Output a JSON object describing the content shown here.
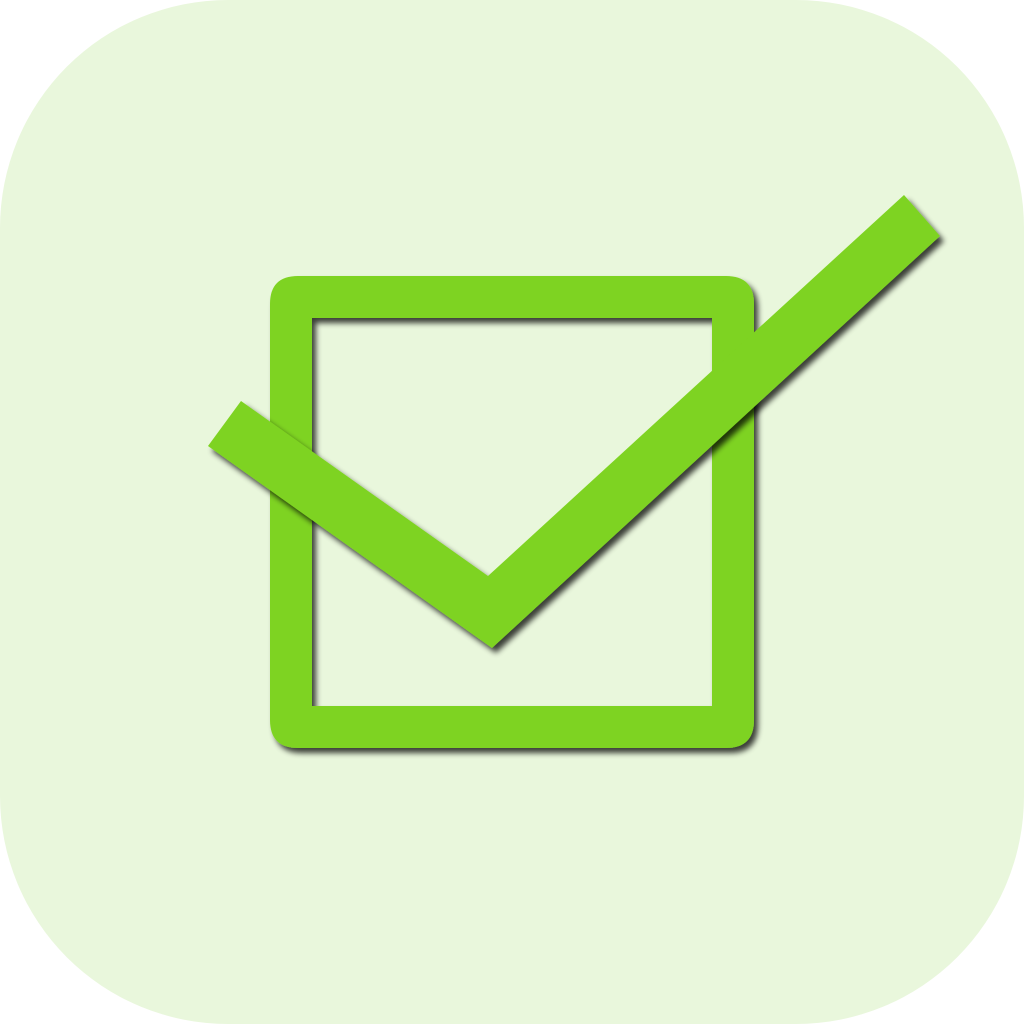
{
  "app_icon": {
    "icon_name": "checkbox-checked-icon",
    "state": "checked",
    "colors": {
      "tile_background": "#e9f7dc",
      "accent_green": "#7ed321",
      "box_interior": "#e9f7dc",
      "shadow": "#1f2a10"
    }
  }
}
